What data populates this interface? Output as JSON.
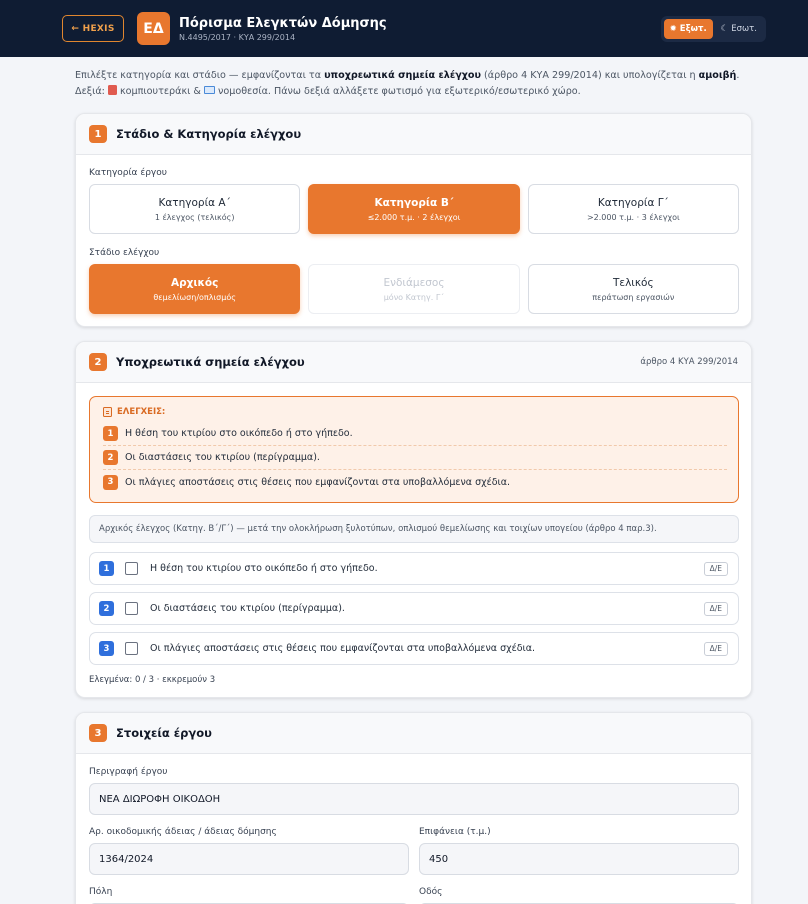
{
  "header": {
    "back_label": "← HEXIS",
    "logo_text": "ΕΔ",
    "title": "Πόρισμα Ελεγκτών Δόμησης",
    "subtitle": "Ν.4495/2017 · ΚΥΑ 299/2014",
    "mode_outdoor": "Εξωτ.",
    "mode_indoor": "Εσωτ."
  },
  "intro": {
    "t1": "Επιλέξτε κατηγορία και στάδιο — εμφανίζονται τα ",
    "b1": "υποχρεωτικά σημεία ελέγχου",
    "t2": " (άρθρο 4 ΚΥΑ 299/2014) και υπολογίζεται η ",
    "b2": "αμοιβή",
    "t3": ". Δεξιά: ",
    "t4": " κομπιουτεράκι & ",
    "t5": " νομοθεσία. Πάνω δεξιά αλλάξετε φωτισμό για εξωτερικό/εσωτερικό χώρο."
  },
  "section1": {
    "num": "1",
    "title": "Στάδιο & Κατηγορία ελέγχου",
    "category_label": "Κατηγορία έργου",
    "categories": [
      {
        "title": "Κατηγορία Α΄",
        "sub": "1 έλεγχος (τελικός)"
      },
      {
        "title": "Κατηγορία Β΄",
        "sub": "≤2.000 τ.μ. · 2 έλεγχοι"
      },
      {
        "title": "Κατηγορία Γ΄",
        "sub": ">2.000 τ.μ. · 3 έλεγχοι"
      }
    ],
    "stage_label": "Στάδιο ελέγχου",
    "stages": [
      {
        "title": "Αρχικός",
        "sub": "θεμελίωση/οπλισμός"
      },
      {
        "title": "Ενδιάμεσος",
        "sub": "μόνο Κατηγ. Γ΄"
      },
      {
        "title": "Τελικός",
        "sub": "περάτωση εργασιών"
      }
    ]
  },
  "section2": {
    "num": "2",
    "title": "Υποχρεωτικά σημεία ελέγχου",
    "ref": "άρθρο 4 ΚΥΑ 299/2014",
    "checks_header": "ΕΛΕΓΧΕΙΣ:",
    "checks": [
      {
        "num": "1",
        "text": "Η θέση του κτιρίου στο οικόπεδο ή στο γήπεδο."
      },
      {
        "num": "2",
        "text": "Οι διαστάσεις του κτιρίου (περίγραμμα)."
      },
      {
        "num": "3",
        "text": "Οι πλάγιες αποστάσεις στις θέσεις που εμφανίζονται στα υποβαλλόμενα σχέδια."
      }
    ],
    "stage_note": "Αρχικός έλεγχος (Κατηγ. Β΄/Γ΄) — μετά την ολοκλήρωση ξυλοτύπων, οπλισμού θεμελίωσης και τοιχίων υπογείου (άρθρο 4 παρ.3).",
    "items": [
      {
        "num": "1",
        "text": "Η θέση του κτιρίου στο οικόπεδο ή στο γήπεδο.",
        "na": "Δ/Ε"
      },
      {
        "num": "2",
        "text": "Οι διαστάσεις του κτιρίου (περίγραμμα).",
        "na": "Δ/Ε"
      },
      {
        "num": "3",
        "text": "Οι πλάγιες αποστάσεις στις θέσεις που εμφανίζονται στα υποβαλλόμενα σχέδια.",
        "na": "Δ/Ε"
      }
    ],
    "progress": "Ελεγμένα: 0 / 3 · εκκρεμούν 3"
  },
  "section3": {
    "num": "3",
    "title": "Στοιχεία έργου",
    "desc_label": "Περιγραφή έργου",
    "desc_value": "ΝΕΑ ΔΙΩΡΟΦΗ ΟΙΚΟΔΟΗ",
    "permit_label": "Αρ. οικοδομικής άδειας / άδειας δόμησης",
    "permit_value": "1364/2024",
    "area_label": "Επιφάνεια (τ.μ.)",
    "area_value": "450",
    "city_label": "Πόλη",
    "street_label": "Οδός"
  },
  "colors": {
    "accent": "#e8772e",
    "header_bg": "#0f1c33",
    "blue": "#2f6fdc"
  }
}
